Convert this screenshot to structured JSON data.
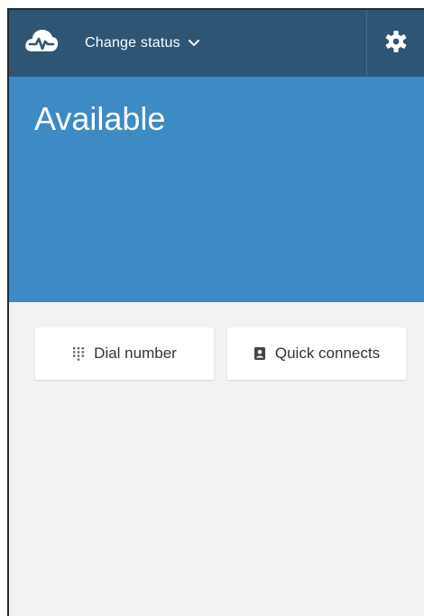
{
  "header": {
    "logo_icon": "cloud-heartbeat-icon",
    "status_toggle_label": "Change status",
    "status_toggle_icon": "chevron-down-icon",
    "settings_icon": "gear-icon",
    "background_color": "#2f5574"
  },
  "status": {
    "title": "Available",
    "background_color": "#3d8ac5"
  },
  "actions": {
    "dial_number": {
      "label": "Dial number",
      "icon": "dialpad-icon"
    },
    "quick_connects": {
      "label": "Quick connects",
      "icon": "contact-book-icon"
    },
    "background_color": "#f2f2f2"
  }
}
